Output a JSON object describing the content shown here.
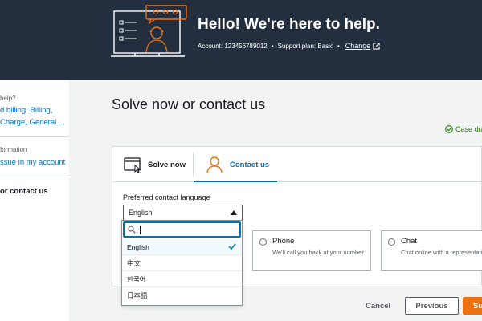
{
  "header": {
    "greeting": "Hello!  We're here to help.",
    "account_label": "Account: 123456789012",
    "support_plan": "Support plan: Basic",
    "change_link": "Change",
    "bg_color": "#232f3e"
  },
  "sidebar": {
    "section1_heading": "help?",
    "section1_line1": "d billing, Billing,",
    "section1_line2": "Charge, General ...",
    "section2_heading": "formation",
    "section2_link": "ssue in my account",
    "active_item": "or contact us"
  },
  "main": {
    "title": "Solve now or contact us",
    "draft_status": "Case dra",
    "tabs": {
      "solve": "Solve now",
      "contact": "Contact us"
    },
    "language_label": "Preferred contact language",
    "language_selected": "English",
    "options": {
      "phone_title": "Phone",
      "phone_desc": "We'll call you back at your number.",
      "chat_title": "Chat",
      "chat_desc": "Chat online with a representative."
    }
  },
  "dropdown": {
    "search_placeholder": "",
    "items": [
      "English",
      "中文",
      "한국어",
      "日本語"
    ],
    "selected_index": 0
  },
  "buttons": {
    "cancel": "Cancel",
    "previous": "Previous",
    "submit": "Su"
  },
  "colors": {
    "link": "#0073bb",
    "primary": "#ec7211",
    "success": "#1d8102"
  }
}
